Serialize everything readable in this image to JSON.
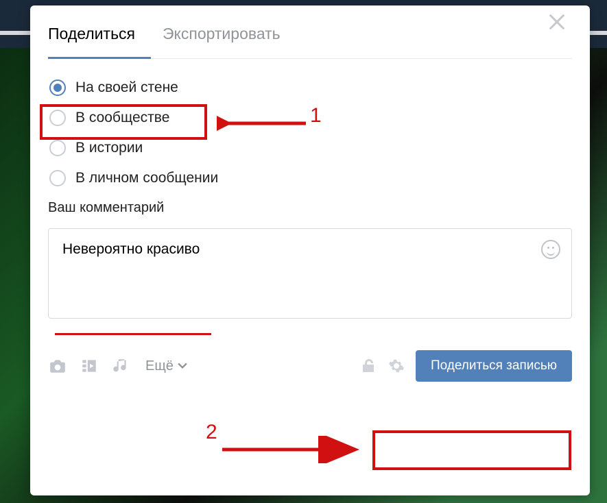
{
  "tabs": {
    "share": "Поделиться",
    "export": "Экспортировать"
  },
  "radios": {
    "wall": "На своей стене",
    "community": "В сообществе",
    "story": "В истории",
    "message": "В личном сообщении"
  },
  "comment": {
    "label": "Ваш комментарий",
    "text": "Невероятно красиво"
  },
  "footer": {
    "more": "Ещё",
    "share_btn": "Поделиться записью"
  },
  "annotations": {
    "one": "1",
    "two": "2"
  }
}
